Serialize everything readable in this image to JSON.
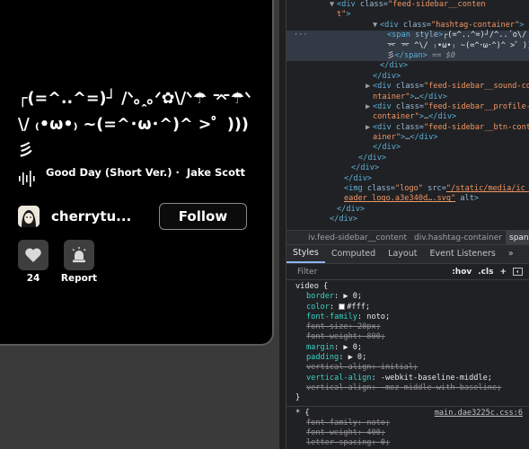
{
  "feed": {
    "hashtag": "┌(=^..^=)┘ /ᐠ｡ꞈ｡ᐟ✿\\/ᐠ☂ ⌤☂ᐠ\\/ ₍•ω•₎ ~(=^･ω･^)^ >゜)))彡",
    "sound": {
      "title": "Good Day (Short Ver.) ·",
      "artist": "Jake Scott"
    },
    "profile": {
      "username": "cherrytu...",
      "follow_label": "Follow"
    },
    "actions": {
      "like_count": "24",
      "report_label": "Report"
    }
  },
  "devtools": {
    "dom_lines": [
      {
        "indent": 5,
        "tri": "▼",
        "html": "<span class=\"tag\">&lt;div</span> <span class=\"attr\">class=</span><span class=\"val\">\"feed-sidebar__content\"</span><span class=\"tag\">&gt;</span>",
        "wrap": "t\">"
      },
      {
        "indent": 6,
        "tri": "▼",
        "html": "<span class=\"tag\">&lt;div</span> <span class=\"attr\">class=</span><span class=\"val\">\"hashtag-container\"</span><span class=\"tag\">&gt;</span>"
      }
    ],
    "breadcrumbs": [
      "iv.feed-sidebar__content",
      "div.hashtag-container",
      "span"
    ],
    "tabs": [
      "Styles",
      "Computed",
      "Layout",
      "Event Listeners",
      "»"
    ],
    "filter_placeholder": "Filter",
    "filter_tools": [
      ":hov",
      ".cls",
      "+"
    ],
    "rule1_selector": "video {",
    "rule1_decls": [
      {
        "prop": "border",
        "value": "▶ 0;",
        "struck": false
      },
      {
        "prop": "color",
        "value": "#fff;",
        "struck": false,
        "swatch": true
      },
      {
        "prop": "font-family",
        "value": "noto;",
        "struck": false
      },
      {
        "prop": "font-size",
        "value": "20px;",
        "struck": true
      },
      {
        "prop": "font-weight",
        "value": "800;",
        "struck": true
      },
      {
        "prop": "margin",
        "value": "▶ 0;",
        "struck": false
      },
      {
        "prop": "padding",
        "value": "▶ 0;",
        "struck": false
      },
      {
        "prop": "vertical-align",
        "value": "initial;",
        "struck": true
      },
      {
        "prop": "vertical-align",
        "value": "-webkit-baseline-middle;",
        "struck": false
      },
      {
        "prop": "vertical-align",
        "value": "-moz-middle-with-baseline;",
        "struck": true
      }
    ],
    "rule1_close": "}",
    "rule2_selector": "* {",
    "rule2_source": "main.dae3225c.css:6",
    "rule2_decls": [
      {
        "prop": "font-family",
        "value": "noto;",
        "struck": true
      },
      {
        "prop": "font-weight",
        "value": "400;",
        "struck": true
      },
      {
        "prop": "letter-spacing",
        "value": "0;",
        "struck": true
      }
    ],
    "rule2_close": "}"
  }
}
